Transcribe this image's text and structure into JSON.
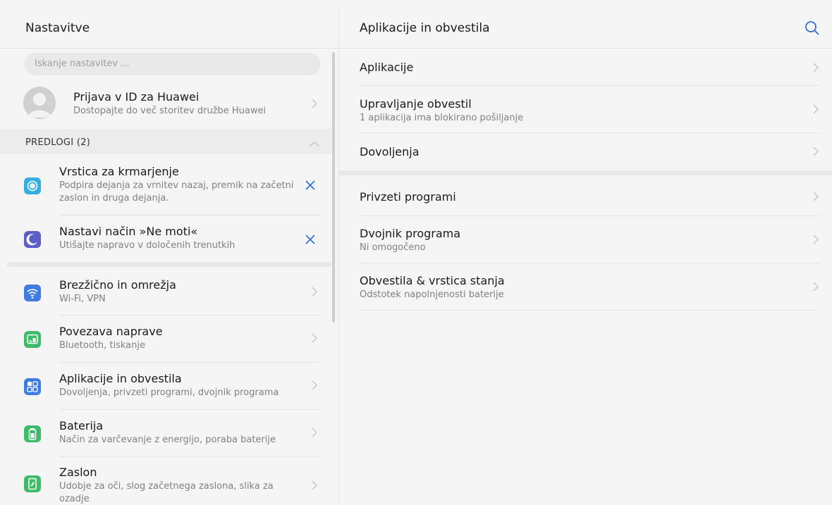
{
  "left": {
    "title": "Nastavitve",
    "search_placeholder": "Iskanje nastavitev ...",
    "account": {
      "title": "Prijava v ID za Huawei",
      "subtitle": "Dostopajte do več storitev družbe Huawei"
    },
    "suggestions": {
      "label": "PREDLOGI (2)",
      "items": [
        {
          "title": "Vrstica za krmarjenje",
          "subtitle": "Podpira dejanja za vrnitev nazaj, premik na začetni zaslon in druga dejanja.",
          "icon": "navigation-bar-icon",
          "color": "#35aee0"
        },
        {
          "title": "Nastavi način »Ne moti«",
          "subtitle": "Utišajte napravo v določenih trenutkih",
          "icon": "moon-icon",
          "color": "#5b5fc7"
        }
      ]
    },
    "items": [
      {
        "title": "Brezžično in omrežja",
        "subtitle": "Wi-Fi, VPN",
        "icon": "wifi-icon",
        "color": "#3f7be0"
      },
      {
        "title": "Povezava naprave",
        "subtitle": "Bluetooth, tiskanje",
        "icon": "device-connection-icon",
        "color": "#3dbb6a"
      },
      {
        "title": "Aplikacije in obvestila",
        "subtitle": "Dovoljenja, privzeti programi, dvojnik programa",
        "icon": "apps-grid-icon",
        "color": "#3f7be0"
      },
      {
        "title": "Baterija",
        "subtitle": "Način za varčevanje z energijo, poraba baterije",
        "icon": "battery-icon",
        "color": "#3dbb6a"
      },
      {
        "title": "Zaslon",
        "subtitle": "Udobje za oči, slog začetnega zaslona, slika za ozadje",
        "icon": "display-icon",
        "color": "#3dbb6a"
      }
    ]
  },
  "right": {
    "title": "Aplikacije in obvestila",
    "items": [
      {
        "title": "Aplikacije",
        "subtitle": ""
      },
      {
        "title": "Upravljanje obvestil",
        "subtitle": "1 aplikacija ima blokirano pošiljanje"
      },
      {
        "title": "Dovoljenja",
        "subtitle": ""
      },
      {
        "title": "Privzeti programi",
        "subtitle": ""
      },
      {
        "title": "Dvojnik programa",
        "subtitle": "Ni omogočeno"
      },
      {
        "title": "Obvestila & vrstica stanja",
        "subtitle": "Odstotek napolnjenosti baterije"
      }
    ]
  },
  "colors": {
    "accent": "#2f6fd6",
    "chevron": "#c4c4c4"
  }
}
